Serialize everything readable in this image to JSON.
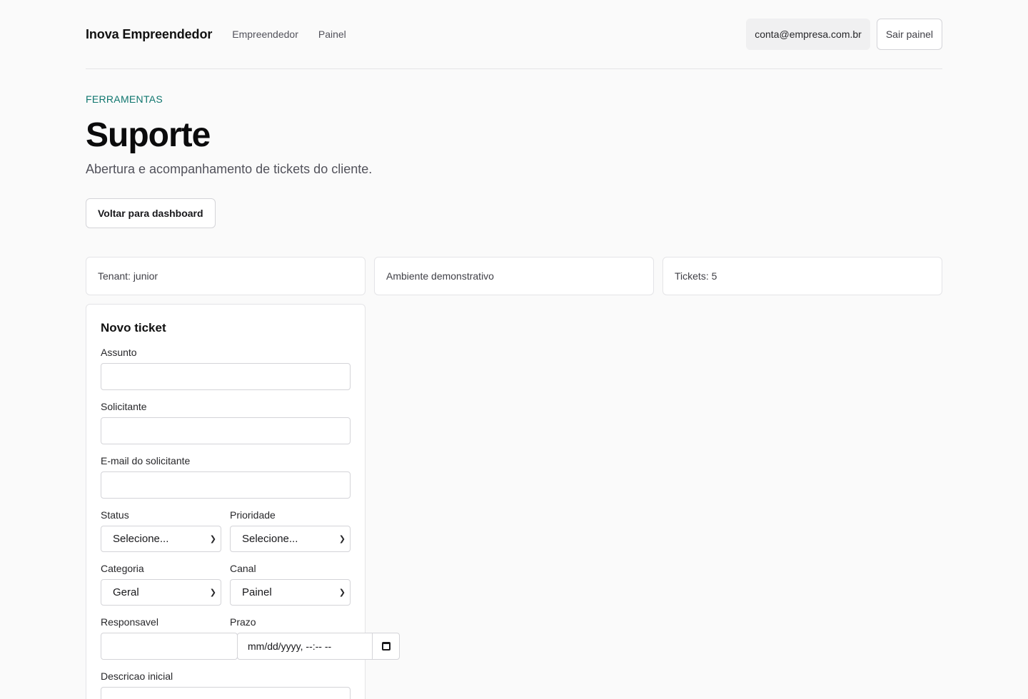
{
  "header": {
    "brand": "Inova Empreendedor",
    "nav": [
      "Empreendedor",
      "Painel"
    ],
    "account_email": "conta@empresa.com.br",
    "logout_label": "Sair painel"
  },
  "page": {
    "eyebrow": "FERRAMENTAS",
    "title": "Suporte",
    "subtitle": "Abertura e acompanhamento de tickets do cliente.",
    "back_button": "Voltar para dashboard"
  },
  "info_cards": [
    "Tenant: junior",
    "Ambiente demonstrativo",
    "Tickets: 5"
  ],
  "form": {
    "title": "Novo ticket",
    "subject_label": "Assunto",
    "requester_label": "Solicitante",
    "email_label": "E-mail do solicitante",
    "status_label": "Status",
    "status_value": "Selecione...",
    "priority_label": "Prioridade",
    "priority_value": "Selecione...",
    "category_label": "Categoria",
    "category_value": "Geral",
    "channel_label": "Canal",
    "channel_value": "Painel",
    "owner_label": "Responsavel",
    "deadline_label": "Prazo",
    "deadline_placeholder": "mm/dd/yyyy, --:-- --",
    "description_label": "Descricao inicial"
  },
  "icons": {
    "select_chevron": "chevron-down-icon",
    "calendar": "calendar-icon"
  },
  "colors": {
    "accent": "#0f766e",
    "background": "#fafafa"
  }
}
